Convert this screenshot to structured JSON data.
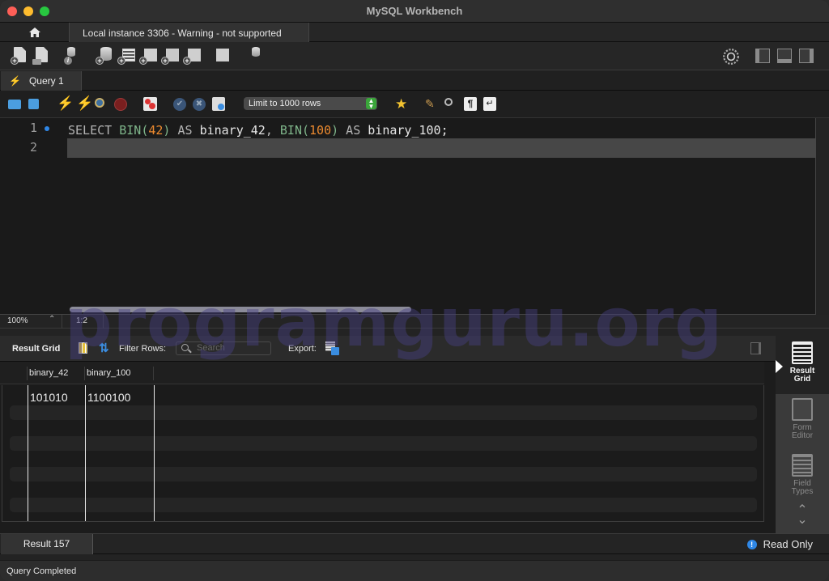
{
  "window": {
    "title": "MySQL Workbench"
  },
  "connection_tabs": {
    "home_icon": "home-icon",
    "active_tab": "Local instance 3306 - Warning - not supported"
  },
  "main_toolbar": {
    "icons": [
      "new-sql-tab-icon",
      "open-sql-file-icon",
      "schema-inspector-icon",
      "create-schema-icon",
      "create-table-icon",
      "create-view-icon",
      "create-procedure-icon",
      "create-function-icon",
      "table-data-search-icon",
      "reconnect-icon"
    ],
    "right_icons": [
      "settings-icon",
      "toggle-sidebar-icon",
      "toggle-output-icon",
      "toggle-secondary-sidebar-icon"
    ]
  },
  "query_tab": {
    "label": "Query 1",
    "icon": "lightning-icon"
  },
  "editor_toolbar": {
    "limit_select": {
      "selected": "Limit to 1000 rows"
    }
  },
  "editor": {
    "line_numbers": [
      "1",
      "2"
    ],
    "line1_tokens": [
      {
        "t": "SELECT",
        "c": "kw"
      },
      {
        "t": " ",
        "c": "id"
      },
      {
        "t": "BIN",
        "c": "fn"
      },
      {
        "t": "(",
        "c": "fn"
      },
      {
        "t": "42",
        "c": "num"
      },
      {
        "t": ")",
        "c": "fn"
      },
      {
        "t": " AS ",
        "c": "kw"
      },
      {
        "t": "binary_42",
        "c": "id"
      },
      {
        "t": ", ",
        "c": "punc"
      },
      {
        "t": "BIN",
        "c": "fn"
      },
      {
        "t": "(",
        "c": "fn"
      },
      {
        "t": "100",
        "c": "num"
      },
      {
        "t": ")",
        "c": "fn"
      },
      {
        "t": " AS ",
        "c": "kw"
      },
      {
        "t": "binary_100",
        "c": "id"
      },
      {
        "t": ";",
        "c": "id"
      }
    ],
    "sql_text": "SELECT BIN(42) AS binary_42, BIN(100) AS binary_100;"
  },
  "editor_status": {
    "zoom": "100%",
    "cursor_position": "1:2"
  },
  "result_toolbar": {
    "label": "Result Grid",
    "filter_label": "Filter Rows:",
    "search_placeholder": "Search",
    "export_label": "Export:"
  },
  "result_grid": {
    "columns": [
      "binary_42",
      "binary_100"
    ],
    "rows": [
      [
        "101010",
        "1100100"
      ]
    ]
  },
  "side_panel": {
    "items": [
      {
        "label_line1": "Result",
        "label_line2": "Grid",
        "active": true
      },
      {
        "label_line1": "Form",
        "label_line2": "Editor",
        "active": false
      },
      {
        "label_line1": "Field",
        "label_line2": "Types",
        "active": false
      }
    ]
  },
  "result_tabs": {
    "active": "Result 157",
    "read_only": "Read Only"
  },
  "status_bar": {
    "text": "Query Completed"
  },
  "watermark": "programguru.org",
  "colors": {
    "accent_blue": "#2f87e6",
    "keyword": "#b4b4b4",
    "function": "#7fb58a",
    "number": "#ec8a2f",
    "limit_arrow_green": "#3aa63a"
  }
}
